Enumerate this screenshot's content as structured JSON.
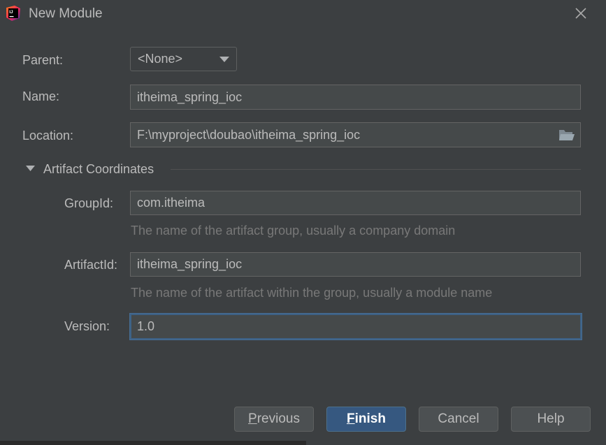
{
  "window": {
    "title": "New Module"
  },
  "form": {
    "parent_label": "Parent:",
    "parent_value": "<None>",
    "name_label": "Name:",
    "name_value": "itheima_spring_ioc",
    "location_label": "Location:",
    "location_value": "F:\\myproject\\doubao\\itheima_spring_ioc"
  },
  "artifact": {
    "section_title": "Artifact Coordinates",
    "groupid_label": "GroupId:",
    "groupid_value": "com.itheima",
    "groupid_hint": "The name of the artifact group, usually a company domain",
    "artifactid_label": "ArtifactId:",
    "artifactid_value": "itheima_spring_ioc",
    "artifactid_hint": "The name of the artifact within the group, usually a module name",
    "version_label": "Version:",
    "version_value": "1.0"
  },
  "buttons": {
    "previous_mnemonic": "P",
    "previous_rest": "revious",
    "finish_mnemonic": "F",
    "finish_rest": "inish",
    "cancel": "Cancel",
    "help": "Help"
  },
  "icons": {
    "app": "intellij-idea-icon",
    "close": "close-icon",
    "folder": "folder-open-icon",
    "dropdown": "chevron-down-icon",
    "section_toggle": "triangle-down-icon"
  },
  "colors": {
    "background": "#3c3f41",
    "field": "#45494a",
    "primary_button": "#365880",
    "focus_border": "#3d6185",
    "hint_text": "#787878"
  }
}
